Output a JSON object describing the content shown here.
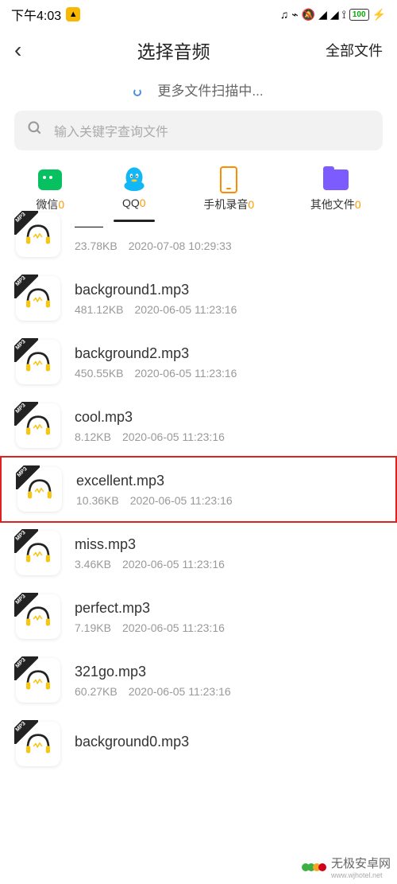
{
  "statusBar": {
    "time": "下午4:03",
    "battery": "100"
  },
  "header": {
    "title": "选择音频",
    "right": "全部文件"
  },
  "scanning": "更多文件扫描中...",
  "search": {
    "placeholder": "输入关键字查询文件"
  },
  "tabs": [
    {
      "label": "微信",
      "count": "0",
      "active": false
    },
    {
      "label": "QQ",
      "count": "0",
      "active": true
    },
    {
      "label": "手机录音",
      "count": "0",
      "active": false
    },
    {
      "label": "其他文件",
      "count": "0",
      "active": false
    }
  ],
  "files": [
    {
      "name": "——",
      "size": "23.78KB",
      "date": "2020-07-08 10:29:33",
      "partial": true
    },
    {
      "name": "background1.mp3",
      "size": "481.12KB",
      "date": "2020-06-05 11:23:16"
    },
    {
      "name": "background2.mp3",
      "size": "450.55KB",
      "date": "2020-06-05 11:23:16"
    },
    {
      "name": "cool.mp3",
      "size": "8.12KB",
      "date": "2020-06-05 11:23:16"
    },
    {
      "name": "excellent.mp3",
      "size": "10.36KB",
      "date": "2020-06-05 11:23:16",
      "highlight": true
    },
    {
      "name": "miss.mp3",
      "size": "3.46KB",
      "date": "2020-06-05 11:23:16"
    },
    {
      "name": "perfect.mp3",
      "size": "7.19KB",
      "date": "2020-06-05 11:23:16"
    },
    {
      "name": "321go.mp3",
      "size": "60.27KB",
      "date": "2020-06-05 11:23:16"
    },
    {
      "name": "background0.mp3",
      "size": "",
      "date": ""
    }
  ],
  "watermark": {
    "title": "无极安卓网",
    "sub": "www.wjhotel.net"
  }
}
